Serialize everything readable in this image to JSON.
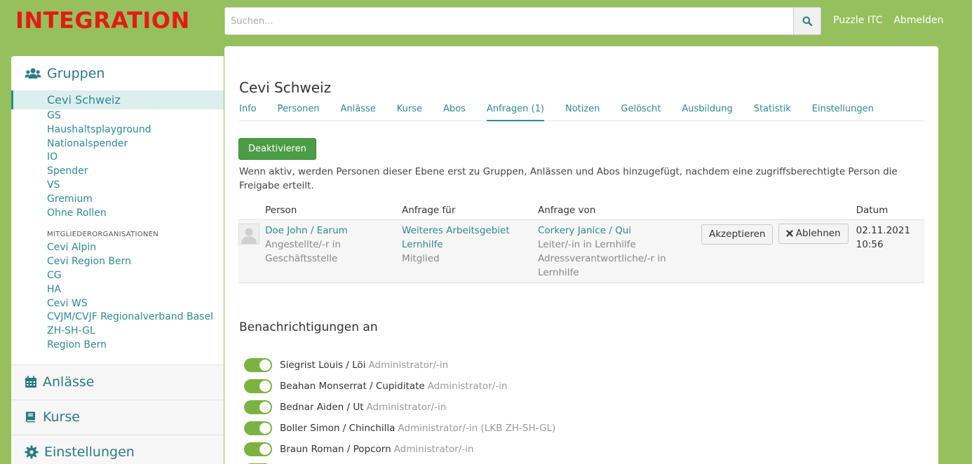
{
  "header": {
    "logo": "INTEGRATION",
    "search_placeholder": "Suchen...",
    "links": [
      "Puzzle ITC",
      "Abmelden"
    ]
  },
  "sidebar": {
    "groups_label": "Gruppen",
    "active_group": "Cevi Schweiz",
    "groups": [
      "GS",
      "Haushaltsplayground",
      "Nationalspender",
      "IO",
      "Spender",
      "VS",
      "Gremium",
      "Ohne Rollen"
    ],
    "section_label": "MITGLIEDERORGANISATIONEN",
    "member_orgs": [
      "Cevi Alpin",
      "Cevi Region Bern",
      "CG",
      "HA",
      "Cevi WS",
      "CVJM/CVJF Regionalverband Basel",
      "ZH-SH-GL",
      "Region Bern"
    ],
    "anlaesse_label": "Anlässe",
    "kurse_label": "Kurse",
    "einstellungen_label": "Einstellungen"
  },
  "main": {
    "title": "Cevi Schweiz",
    "tabs": [
      "Info",
      "Personen",
      "Anlässe",
      "Kurse",
      "Abos",
      "Anfragen (1)",
      "Notizen",
      "Gelöscht",
      "Ausbildung",
      "Statistik",
      "Einstellungen"
    ],
    "active_tab": "Anfragen (1)",
    "deactivate_label": "Deaktivieren",
    "info_text": "Wenn aktiv, werden Personen dieser Ebene erst zu Gruppen, Anlässen und Abos hinzugefügt, nachdem eine zugriffsberechtigte Person die Freigabe erteilt.",
    "table": {
      "headers": [
        "Person",
        "Anfrage für",
        "Anfrage von",
        "Datum"
      ],
      "row": {
        "person_name": "Doe John / Earum",
        "person_role_1": "Angestellte/-r in",
        "person_role_2": "Geschäftsstelle",
        "for_link_1": "Weiteres Arbeitsgebiet",
        "for_link_2": "Lernhilfe",
        "for_role": "Mitglied",
        "from_name": "Corkery Janice / Qui",
        "from_role_1": "Leiter/-in in Lernhilfe",
        "from_role_2": "Adressverantwortliche/-r in",
        "from_role_3": "Lernhilfe",
        "accept_label": "Akzeptieren",
        "reject_label": "Ablehnen",
        "date": "02.11.2021",
        "time": "10:56"
      }
    },
    "notifications_title": "Benachrichtigungen an",
    "notifications": [
      {
        "name": "Siegrist Louis / Löi",
        "role": "Administrator/-in"
      },
      {
        "name": "Beahan Monserrat / Cupiditate",
        "role": "Administrator/-in"
      },
      {
        "name": "Bednar Aiden / Ut",
        "role": "Administrator/-in"
      },
      {
        "name": "Boller Simon / Chinchilla",
        "role": "Administrator/-in (LKB ZH-SH-GL)"
      },
      {
        "name": "Braun Roman / Popcorn",
        "role": "Administrator/-in"
      }
    ]
  },
  "colors": {
    "background": "#95c05d",
    "brand_red": "#e41b13",
    "link_teal": "#2e8a92",
    "button_green": "#4a9c45",
    "toggle_on": "#7bb342"
  }
}
